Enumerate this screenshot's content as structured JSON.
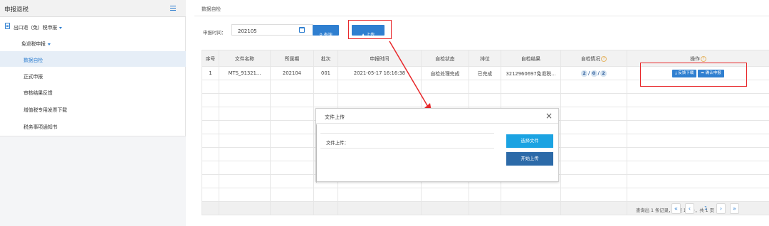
{
  "sidebar": {
    "title": "申报退税",
    "menu": {
      "group": "出口退（免）税申报",
      "subgroup": "免退税申报",
      "items": [
        {
          "label": "数据自检"
        },
        {
          "label": "正式申报"
        },
        {
          "label": "审核结果反馈"
        },
        {
          "label": "增值税专用发票下载"
        },
        {
          "label": "税务事项通知书"
        }
      ]
    }
  },
  "breadcrumb": "数据自检",
  "filter": {
    "label": "申报时间：",
    "value": "202105",
    "query_label": "查询",
    "upload_label": "上传"
  },
  "table": {
    "headers": [
      "序号",
      "文件名称",
      "所属期",
      "批次",
      "申报时间",
      "自检状态",
      "排位",
      "自检结果",
      "自检情况",
      "操作"
    ],
    "row": {
      "index": "1",
      "file": "MTS_91321...",
      "period": "202104",
      "batch": "001",
      "time": "2021-05-17 16:16:38",
      "status": "自检处理完成",
      "rank": "已完成",
      "result": "3212960697免退税...",
      "check_counts": [
        "2",
        "0",
        "2"
      ],
      "feedback_label": "反馈下载",
      "confirm_label": "确认申报"
    }
  },
  "modal": {
    "title": "文件上传",
    "field_label": "文件上传：",
    "select_label": "选择文件",
    "start_label": "开始上传"
  },
  "pager": {
    "summary": "查询出 1 条记录，每页 10 条，共 1 页",
    "current": "1"
  },
  "colors": {
    "primary": "#2f7fd0",
    "highlight": "#e8272a",
    "modal_select": "#1ba3e2",
    "modal_start": "#2c6aa8"
  }
}
